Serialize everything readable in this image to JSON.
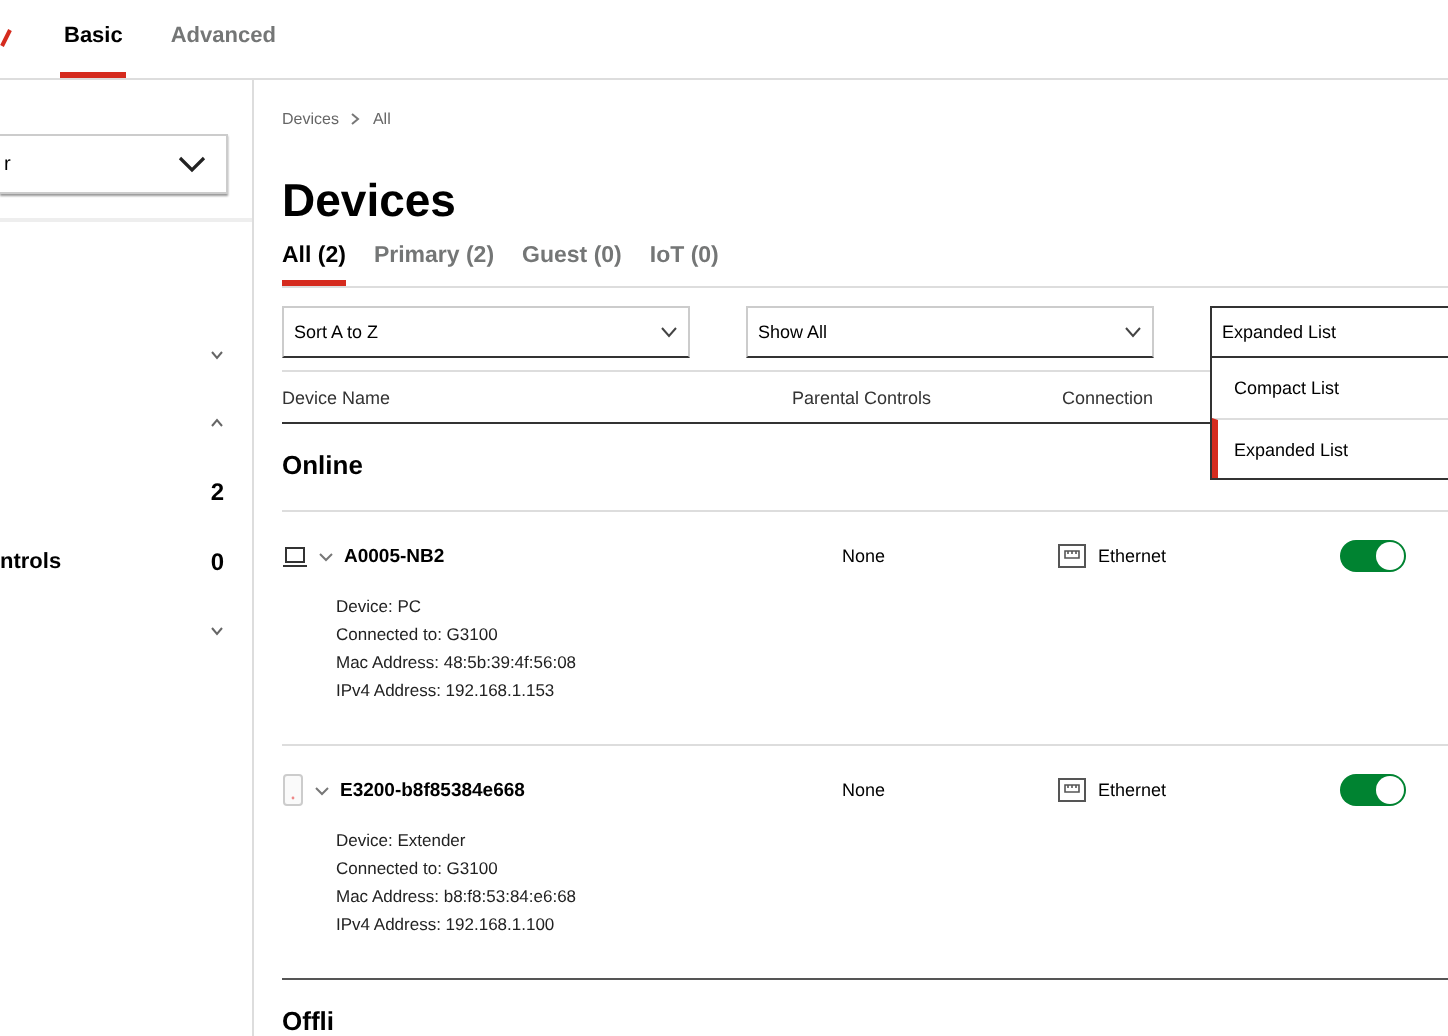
{
  "top_tabs": [
    {
      "label": "Basic",
      "selected": true
    },
    {
      "label": "Advanced",
      "selected": false
    }
  ],
  "sidebar": {
    "select": {
      "value": "r"
    },
    "items": [
      {
        "expanded": false
      },
      {
        "expanded": true
      },
      {
        "count": "2"
      },
      {
        "label": "ntrols",
        "count": "0"
      },
      {
        "expanded": false
      }
    ]
  },
  "breadcrumb": [
    "Devices",
    "All"
  ],
  "title": "Devices",
  "tabs": [
    {
      "label": "All (2)",
      "selected": true
    },
    {
      "label": "Primary (2)",
      "selected": false
    },
    {
      "label": "Guest (0)",
      "selected": false
    },
    {
      "label": "IoT (0)",
      "selected": false
    }
  ],
  "filters": {
    "sort": "Sort A to Z",
    "show": "Show All",
    "view": "Expanded List"
  },
  "view_menu": [
    {
      "label": "Compact List",
      "selected": false
    },
    {
      "label": "Expanded List",
      "selected": true
    }
  ],
  "table": {
    "columns": [
      "Device Name",
      "Parental Controls",
      "Connection"
    ]
  },
  "sections": [
    {
      "heading": "Online",
      "devices": [
        {
          "kind": "laptop",
          "name": "A0005-NB2",
          "parental": "None",
          "connection": "Ethernet",
          "on": true,
          "details": [
            "Device: PC",
            "Connected to: G3100",
            "Mac Address: 48:5b:39:4f:56:08",
            "IPv4 Address: 192.168.1.153"
          ]
        },
        {
          "kind": "extender",
          "name": "E3200-b8f85384e668",
          "parental": "None",
          "connection": "Ethernet",
          "on": true,
          "details": [
            "Device: Extender",
            "Connected to: G3100",
            "Mac Address: b8:f8:53:84:e6:68",
            "IPv4 Address: 192.168.1.100"
          ]
        }
      ]
    },
    {
      "heading": "Offli"
    }
  ]
}
